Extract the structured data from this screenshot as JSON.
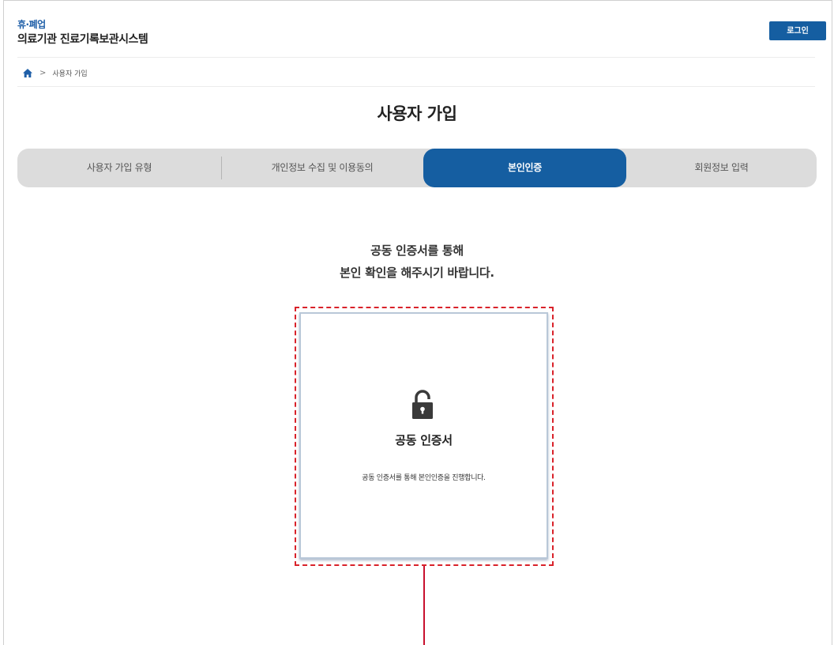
{
  "header": {
    "brand_top": "휴·폐업",
    "brand_main": "의료기관 진료기록보관시스템",
    "login_label": "로그인"
  },
  "breadcrumb": {
    "home_icon": "home-icon",
    "separator": ">",
    "current": "사용자 가입"
  },
  "page": {
    "title": "사용자 가입"
  },
  "steps": [
    {
      "label": "사용자 가입 유형"
    },
    {
      "label": "개인정보 수집 및 이용동의"
    },
    {
      "label": "본인인증"
    },
    {
      "label": "회원정보 입력"
    }
  ],
  "active_step": 3,
  "instruction": {
    "line1": "공동 인증서를 통해",
    "line2": "본인 확인을 해주시기 바랍니다."
  },
  "cert_card": {
    "icon": "lock-icon",
    "title": "공동 인증서",
    "description": "공동 인증서를 통해 본인인증을 진행합니다."
  },
  "colors": {
    "brand_blue": "#155ea1",
    "highlight_red": "#d9222a",
    "step_track": "#dcdcdc"
  }
}
